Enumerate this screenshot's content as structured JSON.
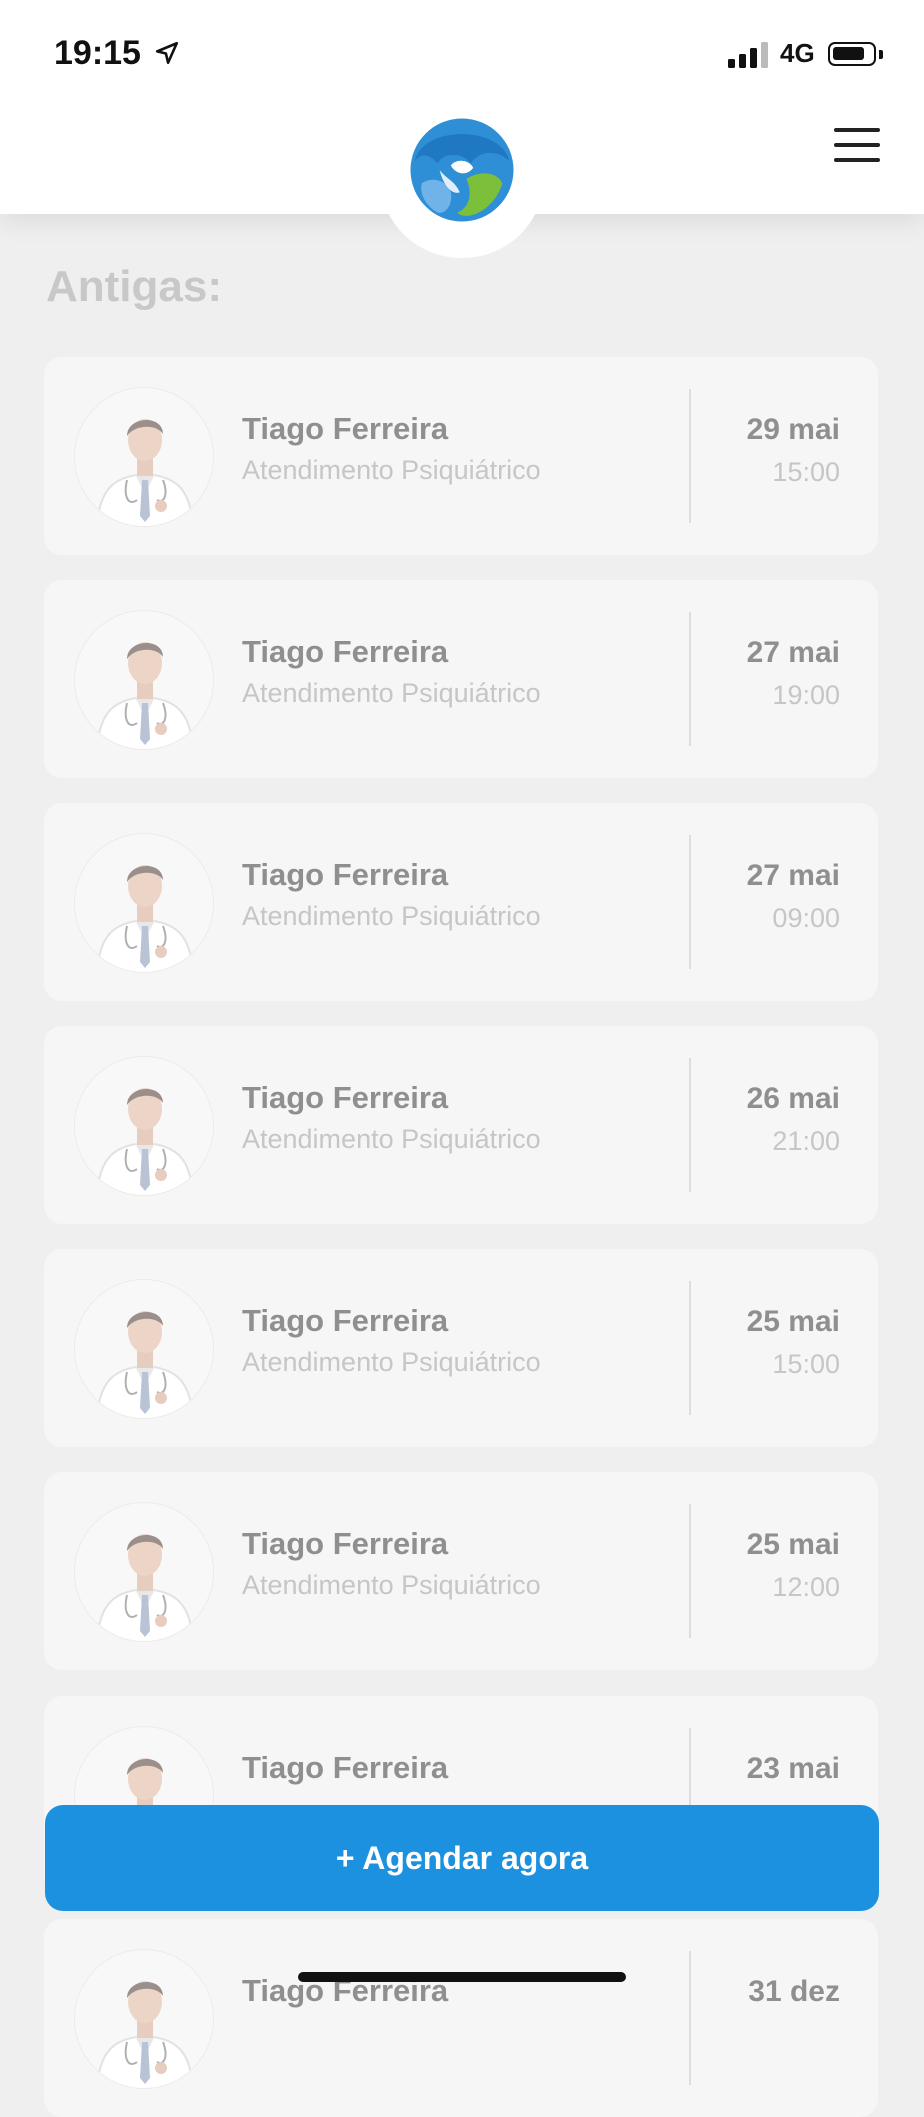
{
  "status_bar": {
    "time": "19:15",
    "network": "4G",
    "icons": [
      "location-arrow-icon",
      "signal-icon",
      "battery-icon"
    ]
  },
  "header": {
    "logo": "app-logo",
    "menu_icon": "hamburger-menu-icon"
  },
  "section": {
    "title": "Antigas:"
  },
  "appointments": [
    {
      "doctor": "Tiago Ferreira",
      "service": "Atendimento Psiquiátrico",
      "date": "29 mai",
      "time": "15:00"
    },
    {
      "doctor": "Tiago Ferreira",
      "service": "Atendimento Psiquiátrico",
      "date": "27 mai",
      "time": "19:00"
    },
    {
      "doctor": "Tiago Ferreira",
      "service": "Atendimento Psiquiátrico",
      "date": "27 mai",
      "time": "09:00"
    },
    {
      "doctor": "Tiago Ferreira",
      "service": "Atendimento Psiquiátrico",
      "date": "26 mai",
      "time": "21:00"
    },
    {
      "doctor": "Tiago Ferreira",
      "service": "Atendimento Psiquiátrico",
      "date": "25 mai",
      "time": "15:00"
    },
    {
      "doctor": "Tiago Ferreira",
      "service": "Atendimento Psiquiátrico",
      "date": "25 mai",
      "time": "12:00"
    },
    {
      "doctor": "Tiago Ferreira",
      "service": "",
      "date": "23 mai",
      "time": ""
    },
    {
      "doctor": "Tiago Ferreira",
      "service": "",
      "date": "31 dez",
      "time": ""
    }
  ],
  "cta": {
    "label": "+ Agendar agora"
  },
  "colors": {
    "accent": "#1b91e0",
    "background": "#efefef",
    "card": "#f6f6f6"
  }
}
